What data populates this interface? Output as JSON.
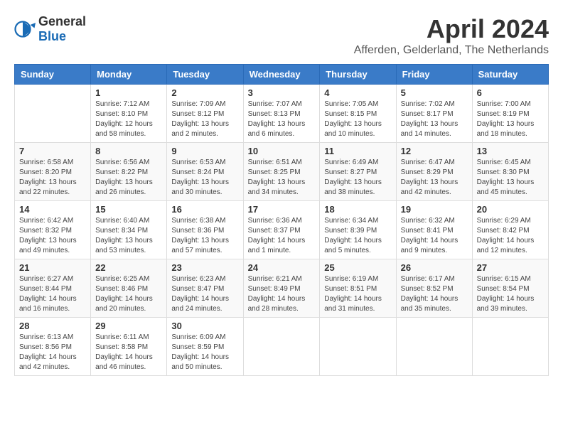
{
  "header": {
    "logo_general": "General",
    "logo_blue": "Blue",
    "month_title": "April 2024",
    "location": "Afferden, Gelderland, The Netherlands"
  },
  "days_of_week": [
    "Sunday",
    "Monday",
    "Tuesday",
    "Wednesday",
    "Thursday",
    "Friday",
    "Saturday"
  ],
  "weeks": [
    [
      {
        "day": "",
        "info": ""
      },
      {
        "day": "1",
        "info": "Sunrise: 7:12 AM\nSunset: 8:10 PM\nDaylight: 12 hours and 58 minutes."
      },
      {
        "day": "2",
        "info": "Sunrise: 7:09 AM\nSunset: 8:12 PM\nDaylight: 13 hours and 2 minutes."
      },
      {
        "day": "3",
        "info": "Sunrise: 7:07 AM\nSunset: 8:13 PM\nDaylight: 13 hours and 6 minutes."
      },
      {
        "day": "4",
        "info": "Sunrise: 7:05 AM\nSunset: 8:15 PM\nDaylight: 13 hours and 10 minutes."
      },
      {
        "day": "5",
        "info": "Sunrise: 7:02 AM\nSunset: 8:17 PM\nDaylight: 13 hours and 14 minutes."
      },
      {
        "day": "6",
        "info": "Sunrise: 7:00 AM\nSunset: 8:19 PM\nDaylight: 13 hours and 18 minutes."
      }
    ],
    [
      {
        "day": "7",
        "info": "Sunrise: 6:58 AM\nSunset: 8:20 PM\nDaylight: 13 hours and 22 minutes."
      },
      {
        "day": "8",
        "info": "Sunrise: 6:56 AM\nSunset: 8:22 PM\nDaylight: 13 hours and 26 minutes."
      },
      {
        "day": "9",
        "info": "Sunrise: 6:53 AM\nSunset: 8:24 PM\nDaylight: 13 hours and 30 minutes."
      },
      {
        "day": "10",
        "info": "Sunrise: 6:51 AM\nSunset: 8:25 PM\nDaylight: 13 hours and 34 minutes."
      },
      {
        "day": "11",
        "info": "Sunrise: 6:49 AM\nSunset: 8:27 PM\nDaylight: 13 hours and 38 minutes."
      },
      {
        "day": "12",
        "info": "Sunrise: 6:47 AM\nSunset: 8:29 PM\nDaylight: 13 hours and 42 minutes."
      },
      {
        "day": "13",
        "info": "Sunrise: 6:45 AM\nSunset: 8:30 PM\nDaylight: 13 hours and 45 minutes."
      }
    ],
    [
      {
        "day": "14",
        "info": "Sunrise: 6:42 AM\nSunset: 8:32 PM\nDaylight: 13 hours and 49 minutes."
      },
      {
        "day": "15",
        "info": "Sunrise: 6:40 AM\nSunset: 8:34 PM\nDaylight: 13 hours and 53 minutes."
      },
      {
        "day": "16",
        "info": "Sunrise: 6:38 AM\nSunset: 8:36 PM\nDaylight: 13 hours and 57 minutes."
      },
      {
        "day": "17",
        "info": "Sunrise: 6:36 AM\nSunset: 8:37 PM\nDaylight: 14 hours and 1 minute."
      },
      {
        "day": "18",
        "info": "Sunrise: 6:34 AM\nSunset: 8:39 PM\nDaylight: 14 hours and 5 minutes."
      },
      {
        "day": "19",
        "info": "Sunrise: 6:32 AM\nSunset: 8:41 PM\nDaylight: 14 hours and 9 minutes."
      },
      {
        "day": "20",
        "info": "Sunrise: 6:29 AM\nSunset: 8:42 PM\nDaylight: 14 hours and 12 minutes."
      }
    ],
    [
      {
        "day": "21",
        "info": "Sunrise: 6:27 AM\nSunset: 8:44 PM\nDaylight: 14 hours and 16 minutes."
      },
      {
        "day": "22",
        "info": "Sunrise: 6:25 AM\nSunset: 8:46 PM\nDaylight: 14 hours and 20 minutes."
      },
      {
        "day": "23",
        "info": "Sunrise: 6:23 AM\nSunset: 8:47 PM\nDaylight: 14 hours and 24 minutes."
      },
      {
        "day": "24",
        "info": "Sunrise: 6:21 AM\nSunset: 8:49 PM\nDaylight: 14 hours and 28 minutes."
      },
      {
        "day": "25",
        "info": "Sunrise: 6:19 AM\nSunset: 8:51 PM\nDaylight: 14 hours and 31 minutes."
      },
      {
        "day": "26",
        "info": "Sunrise: 6:17 AM\nSunset: 8:52 PM\nDaylight: 14 hours and 35 minutes."
      },
      {
        "day": "27",
        "info": "Sunrise: 6:15 AM\nSunset: 8:54 PM\nDaylight: 14 hours and 39 minutes."
      }
    ],
    [
      {
        "day": "28",
        "info": "Sunrise: 6:13 AM\nSunset: 8:56 PM\nDaylight: 14 hours and 42 minutes."
      },
      {
        "day": "29",
        "info": "Sunrise: 6:11 AM\nSunset: 8:58 PM\nDaylight: 14 hours and 46 minutes."
      },
      {
        "day": "30",
        "info": "Sunrise: 6:09 AM\nSunset: 8:59 PM\nDaylight: 14 hours and 50 minutes."
      },
      {
        "day": "",
        "info": ""
      },
      {
        "day": "",
        "info": ""
      },
      {
        "day": "",
        "info": ""
      },
      {
        "day": "",
        "info": ""
      }
    ]
  ]
}
